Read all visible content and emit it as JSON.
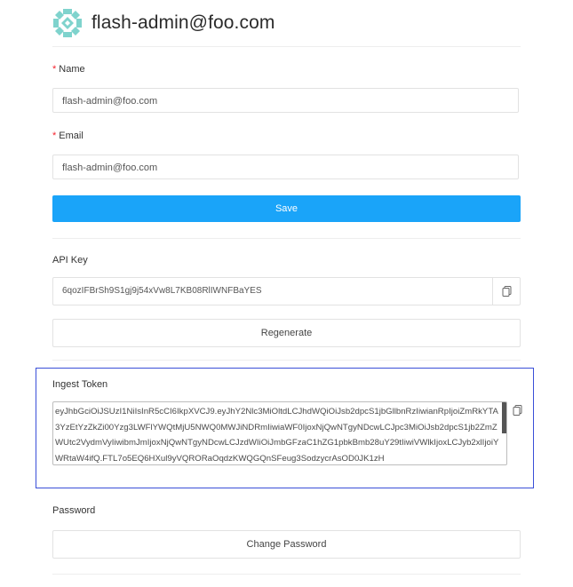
{
  "profile": {
    "title": "flash-admin@foo.com"
  },
  "form": {
    "name_label": "Name",
    "name_value": "flash-admin@foo.com",
    "email_label": "Email",
    "email_value": "flash-admin@foo.com",
    "save_label": "Save"
  },
  "api_key": {
    "label": "API Key",
    "value": "6qozIFBrSh9S1gj9j54xVw8L7KB08RlIWNFBaYES",
    "regenerate_label": "Regenerate"
  },
  "ingest_token": {
    "label": "Ingest Token",
    "value": "eyJhbGciOiJSUzI1NiIsInR5cCI6IkpXVCJ9.eyJhY2Nlc3MiOltdLCJhdWQiOiJsb2dpcS1jbGllbnRzIiwianRpIjoiZmRkYTA3YzEtYzZkZi00Yzg3LWFlYWQtMjU5NWQ0MWJiNDRmIiwiaWF0IjoxNjQwNTgyNDcwLCJpc3MiOiJsb2dpcS1jb2ZmZWUtc2VydmVyIiwibmJmIjoxNjQwNTgyNDcwLCJzdWIiOiJmbGFzaC1hZG1pbkBmb28uY29tIiwiVWlkIjoxLCJyb2xlIjoiYWRtaW4ifQ.FTL7o5EQ6HXul9yVQRORaOqdzKWQGQnSFeug3SodzycrAsOD0JK1zH"
  },
  "password": {
    "label": "Password",
    "change_label": "Change Password"
  },
  "colors": {
    "primary": "#1aa4f9",
    "required": "#f5222d",
    "focus_outline": "#3a4fd8"
  }
}
